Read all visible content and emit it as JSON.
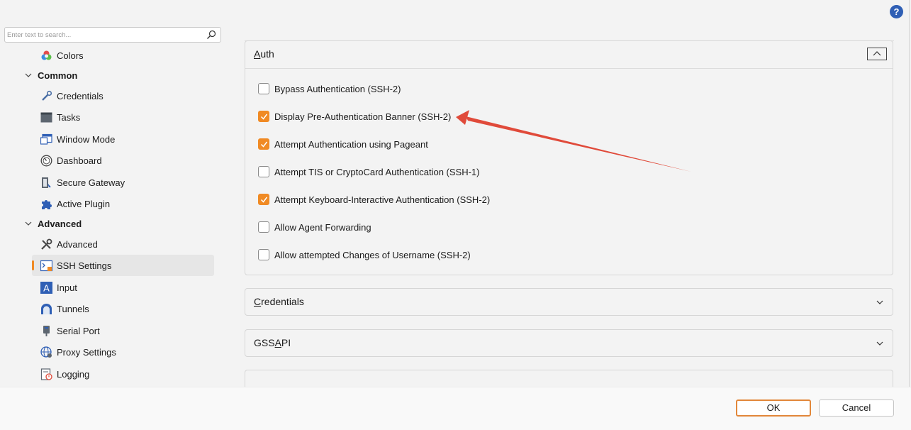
{
  "help": {
    "label": "?"
  },
  "search": {
    "placeholder": "Enter text to search..."
  },
  "sidebar": {
    "items": [
      {
        "label": "Colors",
        "icon": "colors-icon"
      },
      {
        "label": "Common",
        "icon": "chevron-down-icon"
      },
      {
        "label": "Credentials",
        "icon": "credentials-icon"
      },
      {
        "label": "Tasks",
        "icon": "tasks-icon"
      },
      {
        "label": "Window Mode",
        "icon": "window-mode-icon"
      },
      {
        "label": "Dashboard",
        "icon": "dashboard-icon"
      },
      {
        "label": "Secure Gateway",
        "icon": "secure-gateway-icon"
      },
      {
        "label": "Active Plugin",
        "icon": "plugin-icon"
      },
      {
        "label": "Advanced",
        "icon": "chevron-down-icon"
      },
      {
        "label": "Advanced",
        "icon": "tools-icon"
      },
      {
        "label": "SSH Settings",
        "icon": "ssh-settings-icon"
      },
      {
        "label": "Input",
        "icon": "input-icon"
      },
      {
        "label": "Tunnels",
        "icon": "tunnels-icon"
      },
      {
        "label": "Serial Port",
        "icon": "serial-port-icon"
      },
      {
        "label": "Proxy Settings",
        "icon": "proxy-settings-icon"
      },
      {
        "label": "Logging",
        "icon": "logging-icon"
      }
    ],
    "selected": "SSH Settings"
  },
  "sections": {
    "auth": {
      "title_first": "A",
      "title_rest": "uth",
      "expanded": true,
      "options": [
        {
          "label": "Bypass Authentication (SSH-2)",
          "checked": false
        },
        {
          "label": "Display Pre-Authentication Banner (SSH-2)",
          "checked": true
        },
        {
          "label": "Attempt Authentication using Pageant",
          "checked": true
        },
        {
          "label": "Attempt TIS or CryptoCard Authentication (SSH-1)",
          "checked": false
        },
        {
          "label": "Attempt Keyboard-Interactive Authentication (SSH-2)",
          "checked": true
        },
        {
          "label": "Allow Agent Forwarding",
          "checked": false
        },
        {
          "label": "Allow attempted Changes of Username (SSH-2)",
          "checked": false
        }
      ]
    },
    "credentials": {
      "title_first": "C",
      "title_rest": "redentials",
      "expanded": false
    },
    "gssapi": {
      "title_pre": "GSS",
      "title_ul": "A",
      "title_post": "PI",
      "expanded": false
    }
  },
  "footer": {
    "ok_label": "OK",
    "cancel_label": "Cancel"
  },
  "colors": {
    "accent": "#f08a24",
    "annotation_arrow": "#e04a3a"
  }
}
